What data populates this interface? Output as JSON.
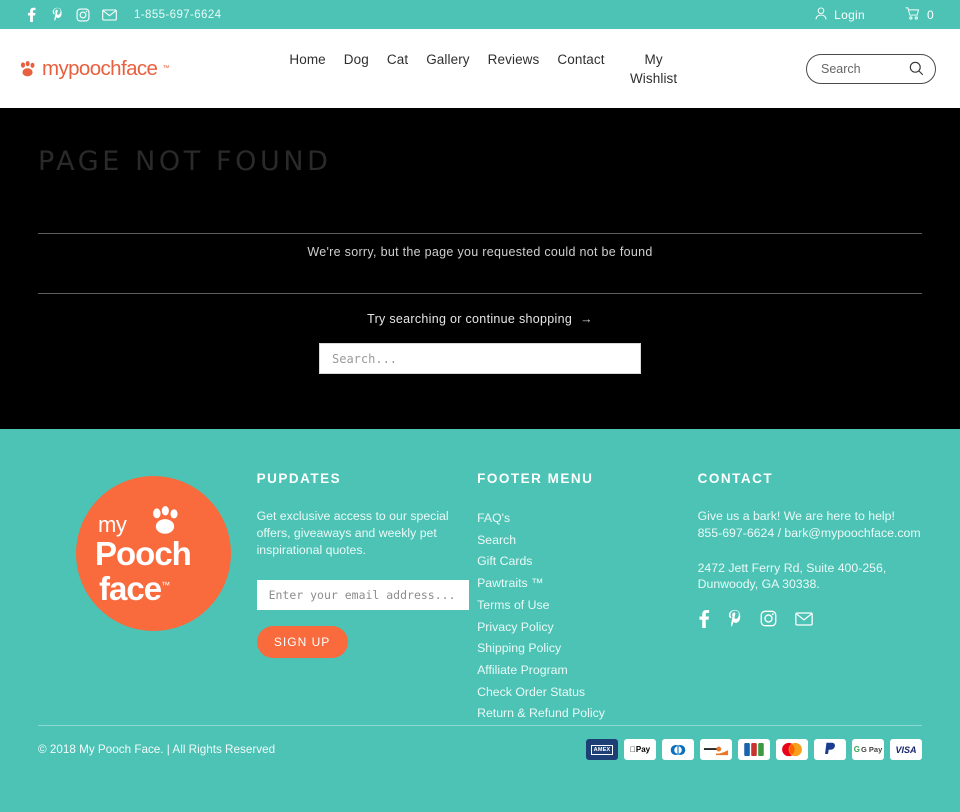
{
  "topbar": {
    "social": [
      {
        "name": "facebook-icon",
        "label": "Facebook"
      },
      {
        "name": "pinterest-icon",
        "label": "Pinterest"
      },
      {
        "name": "instagram-icon",
        "label": "Instagram"
      },
      {
        "name": "email-icon",
        "label": "Email"
      }
    ],
    "phone": "1-855-697-6624",
    "login_label": "Login",
    "cart_count": "0"
  },
  "header": {
    "logo_text": "mypoochface",
    "logo_tm": "™",
    "nav": [
      {
        "label": "Home"
      },
      {
        "label": "Dog"
      },
      {
        "label": "Cat"
      },
      {
        "label": "Gallery"
      },
      {
        "label": "Reviews"
      },
      {
        "label": "Contact"
      },
      {
        "label": "My Wishlist"
      }
    ],
    "search_placeholder": "Search"
  },
  "main": {
    "heading": "PAGE NOT FOUND",
    "sorry_text": "We're sorry, but the page you requested could not be found",
    "try_text": "Try searching or continue shopping",
    "try_arrow": "→",
    "search_placeholder": "Search..."
  },
  "footer": {
    "logo": {
      "line1": "my",
      "line2": "Pooch",
      "line3": "face",
      "tm": "™"
    },
    "pupdates": {
      "title": "PUPDATES",
      "body": "Get exclusive access to our special offers, giveaways and weekly pet inspirational quotes.",
      "email_placeholder": "Enter your email address...",
      "signup_label": "SIGN UP"
    },
    "menu": {
      "title": "FOOTER MENU",
      "items": [
        {
          "label": "FAQ's"
        },
        {
          "label": "Search"
        },
        {
          "label": "Gift Cards"
        },
        {
          "label": "Pawtraits ™"
        },
        {
          "label": "Terms of Use"
        },
        {
          "label": "Privacy Policy"
        },
        {
          "label": "Shipping Policy"
        },
        {
          "label": "Affiliate Program"
        },
        {
          "label": "Check Order Status"
        },
        {
          "label": "Return & Refund Policy"
        }
      ]
    },
    "contact": {
      "title": "CONTACT",
      "line1": "Give us a bark! We are here to help! 855-697-6624 / bark@mypoochface.com",
      "line2": "2472 Jett Ferry Rd, Suite 400-256, Dunwoody, GA  30338.",
      "social": [
        {
          "name": "facebook-icon",
          "label": "Facebook"
        },
        {
          "name": "pinterest-icon",
          "label": "Pinterest"
        },
        {
          "name": "instagram-icon",
          "label": "Instagram"
        },
        {
          "name": "email-icon",
          "label": "Email"
        }
      ]
    },
    "copyright": "© 2018 My Pooch Face. | All Rights Reserved",
    "payments": [
      {
        "name": "amex",
        "label": "AMEX"
      },
      {
        "name": "applepay",
        "label": "Pay"
      },
      {
        "name": "diners",
        "label": "Diners"
      },
      {
        "name": "discover",
        "label": "DISCOVER"
      },
      {
        "name": "jcb",
        "label": "JCB"
      },
      {
        "name": "mastercard",
        "label": "Mastercard"
      },
      {
        "name": "paypal",
        "label": "PayPal"
      },
      {
        "name": "googlepay",
        "label": "G Pay"
      },
      {
        "name": "visa",
        "label": "VISA"
      }
    ]
  },
  "colors": {
    "teal": "#4cc3b5",
    "orange": "#f96a3c",
    "logo_orange": "#e8603f",
    "black": "#000000"
  }
}
